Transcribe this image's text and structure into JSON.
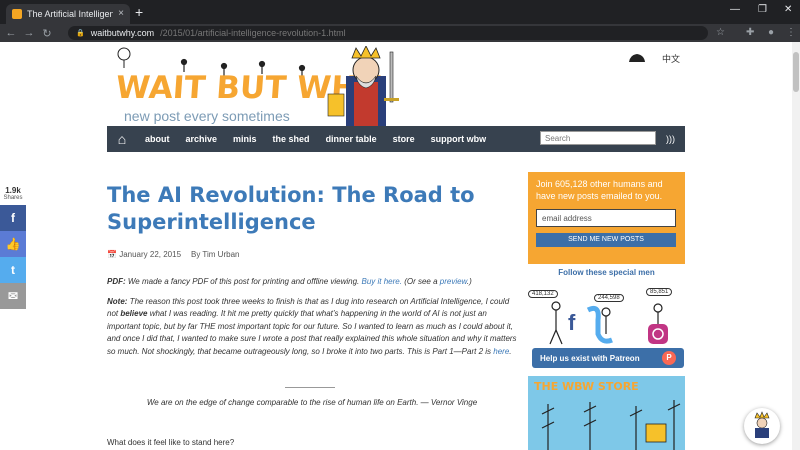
{
  "browser": {
    "tab_title": "The Artificial Intelligence Revolu...",
    "tab_close": "×",
    "new_tab": "+",
    "url_domain": "waitbutwhy.com",
    "url_path": "/2015/01/artificial-intelligence-revolution-1.html"
  },
  "header": {
    "logo_text": "WAIT BUT WHY",
    "tagline": "new post every sometimes",
    "language": "中文"
  },
  "nav": {
    "items": [
      "about",
      "archive",
      "minis",
      "the shed",
      "dinner table",
      "store",
      "support wbw"
    ],
    "search_placeholder": "Search"
  },
  "share": {
    "count": "1.9k",
    "label": "Shares"
  },
  "article": {
    "title": "The AI Revolution: The Road to Superintelligence",
    "date": "January 22, 2015",
    "author": "By Tim Urban",
    "pdf_label": "PDF:",
    "pdf_text": " We made a fancy PDF of this post for printing and offline viewing. ",
    "pdf_link": "Buy it here.",
    "pdf_tail_1": " (Or see a ",
    "pdf_preview": "preview",
    "pdf_tail_2": ".)",
    "note_label": "Note:",
    "note_text_1": " The reason this post took three weeks to finish is that as I dug into research on Artificial Intelligence, I could not ",
    "note_bold": "believe",
    "note_text_2": " what I was reading. It hit me pretty quickly that what’s happening in the world of AI is not just an important topic, but by far THE most important topic for our future. So I wanted to learn as much as I could about it, and once I did that, I wanted to make sure I wrote a post that really explained this whole situation and why it matters so much. Not shockingly, that became outrageously long, so I broke it into two parts. This is Part 1—Part 2 is ",
    "note_link": "here",
    "note_end": ".",
    "quote": "We are on the edge of change comparable to the rise of human life on Earth. — Vernor Vinge",
    "question": "What does it feel like to stand here?"
  },
  "sidebar": {
    "signup_text": "Join 605,128 other humans and have new posts emailed to you.",
    "email_placeholder": "email address",
    "signup_button": "SEND ME NEW POSTS",
    "follow_title": "Follow these special men",
    "facebook_count": "418,132",
    "twitter_count": "244,598",
    "instagram_count": "85,851",
    "patreon_text": "Help us exist with Patreon",
    "store_title": "THE WBW STORE"
  },
  "colors": {
    "brand_orange": "#f6a632",
    "nav_bg": "#37424f",
    "title_blue": "#3d7ab8",
    "facebook": "#3b5998",
    "twitter": "#55acee",
    "email_gray": "#999999"
  }
}
